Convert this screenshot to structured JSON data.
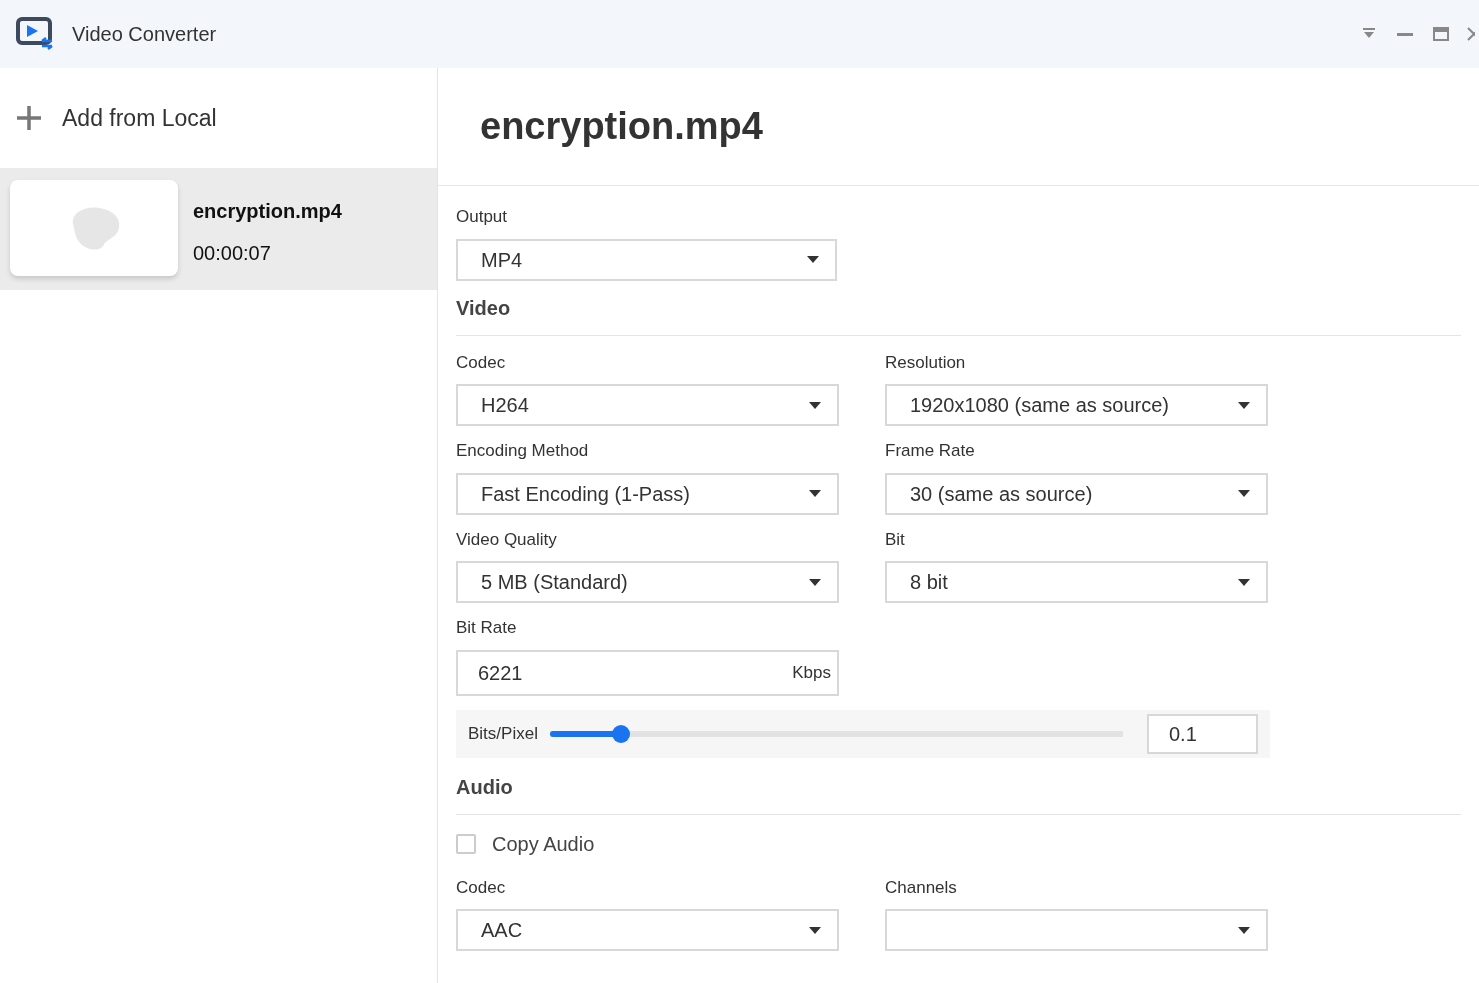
{
  "window": {
    "title": "Video Converter"
  },
  "sidebar": {
    "add_label": "Add from Local",
    "files": [
      {
        "name": "encryption.mp4",
        "duration": "00:00:07",
        "selected": true
      }
    ]
  },
  "main": {
    "title": "encryption.mp4",
    "output": {
      "label": "Output",
      "value": "MP4"
    },
    "video": {
      "heading": "Video",
      "fields": [
        {
          "kind": "select",
          "label": "Codec",
          "value": "H264"
        },
        {
          "kind": "select",
          "label": "Resolution",
          "value": "1920x1080 (same as source)"
        },
        {
          "kind": "select",
          "label": "Encoding Method",
          "value": "Fast Encoding (1-Pass)"
        },
        {
          "kind": "select",
          "label": "Frame Rate",
          "value": "30 (same as source)"
        },
        {
          "kind": "select",
          "label": "Video Quality",
          "value": "5 MB (Standard)"
        },
        {
          "kind": "select",
          "label": "Bit",
          "value": "8 bit"
        },
        {
          "kind": "number",
          "label": "Bit Rate",
          "value": "6221",
          "unit": "Kbps"
        }
      ],
      "bits_pixel": {
        "label": "Bits/Pixel",
        "level": 0.124,
        "value": "0.1"
      }
    },
    "audio": {
      "heading": "Audio",
      "copy_audio": {
        "label": "Copy Audio",
        "checked": false
      },
      "fields": [
        {
          "kind": "select",
          "label": "Codec",
          "value": "AAC"
        },
        {
          "kind": "select",
          "label": "Channels"
        }
      ]
    }
  }
}
